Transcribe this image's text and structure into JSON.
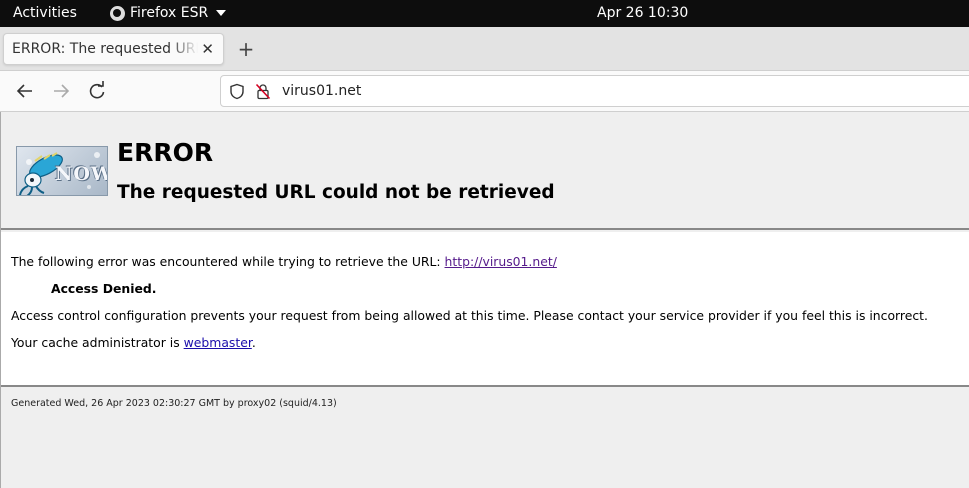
{
  "system_bar": {
    "activities": "Activities",
    "app_name": "Firefox ESR",
    "clock": "Apr 26  10:30"
  },
  "tab": {
    "title": "ERROR: The requested URL could not be retrieved",
    "close": "✕",
    "new_tab": "+"
  },
  "address_bar": {
    "url": "virus01.net"
  },
  "page": {
    "heading": "ERROR",
    "subheading": "The requested URL could not be retrieved",
    "intro_text": "The following error was encountered while trying to retrieve the URL:",
    "intro_link": "http://virus01.net/",
    "denied": "Access Denied.",
    "explanation": "Access control configuration prevents your request from being allowed at this time. Please contact your service provider if you feel this is incorrect.",
    "admin_text": "Your cache administrator is",
    "admin_link": "webmaster",
    "admin_suffix": ".",
    "logo_text": "NOW",
    "footer": "Generated Wed, 26 Apr 2023 02:30:27 GMT by proxy02 (squid/4.13)"
  }
}
